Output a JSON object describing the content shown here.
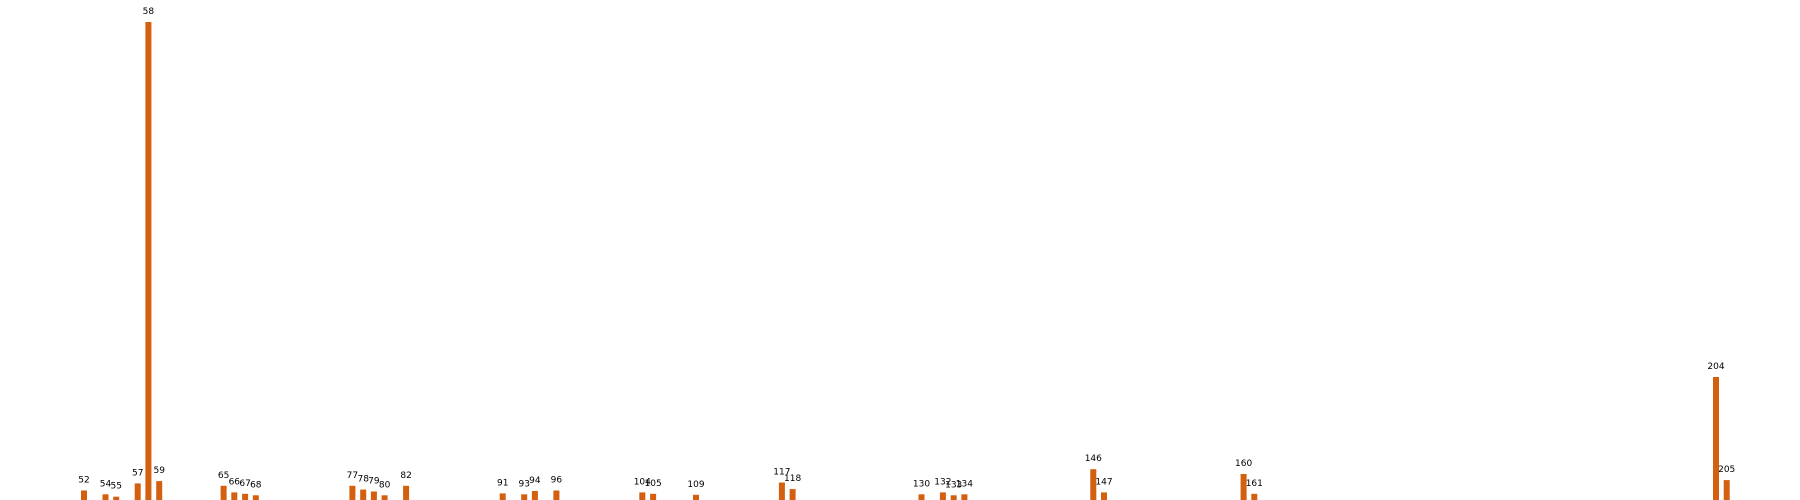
{
  "chart_data": {
    "type": "bar",
    "x": [
      52,
      54,
      55,
      57,
      58,
      59,
      65,
      66,
      67,
      68,
      77,
      78,
      79,
      80,
      82,
      91,
      93,
      94,
      96,
      104,
      105,
      109,
      117,
      118,
      130,
      132,
      133,
      134,
      146,
      147,
      160,
      161,
      204,
      205
    ],
    "values": [
      2.0,
      1.2,
      0.7,
      3.5,
      101.0,
      4.0,
      3.0,
      1.6,
      1.3,
      1.0,
      3.0,
      2.2,
      1.8,
      1.0,
      3.0,
      1.4,
      1.2,
      1.9,
      2.0,
      1.6,
      1.3,
      1.1,
      3.7,
      2.3,
      1.2,
      1.6,
      1.0,
      1.2,
      6.5,
      1.6,
      5.5,
      1.3,
      26.0,
      4.2
    ],
    "labels": [
      "52",
      "54",
      "55",
      "57",
      "58",
      "59",
      "65",
      "66",
      "67",
      "68",
      "77",
      "78",
      "79",
      "80",
      "82",
      "91",
      "93",
      "94",
      "96",
      "104",
      "105",
      "109",
      "117",
      "118",
      "130",
      "132",
      "133",
      "134",
      "146",
      "147",
      "160",
      "161",
      "204",
      "205"
    ],
    "xlim": [
      45,
      215
    ],
    "ylim": [
      0,
      104
    ],
    "bar_color": "#d35f0f",
    "label_color": "#000000",
    "background": "#ffffff",
    "axes_visible": false,
    "grid": false,
    "legend": "none"
  }
}
